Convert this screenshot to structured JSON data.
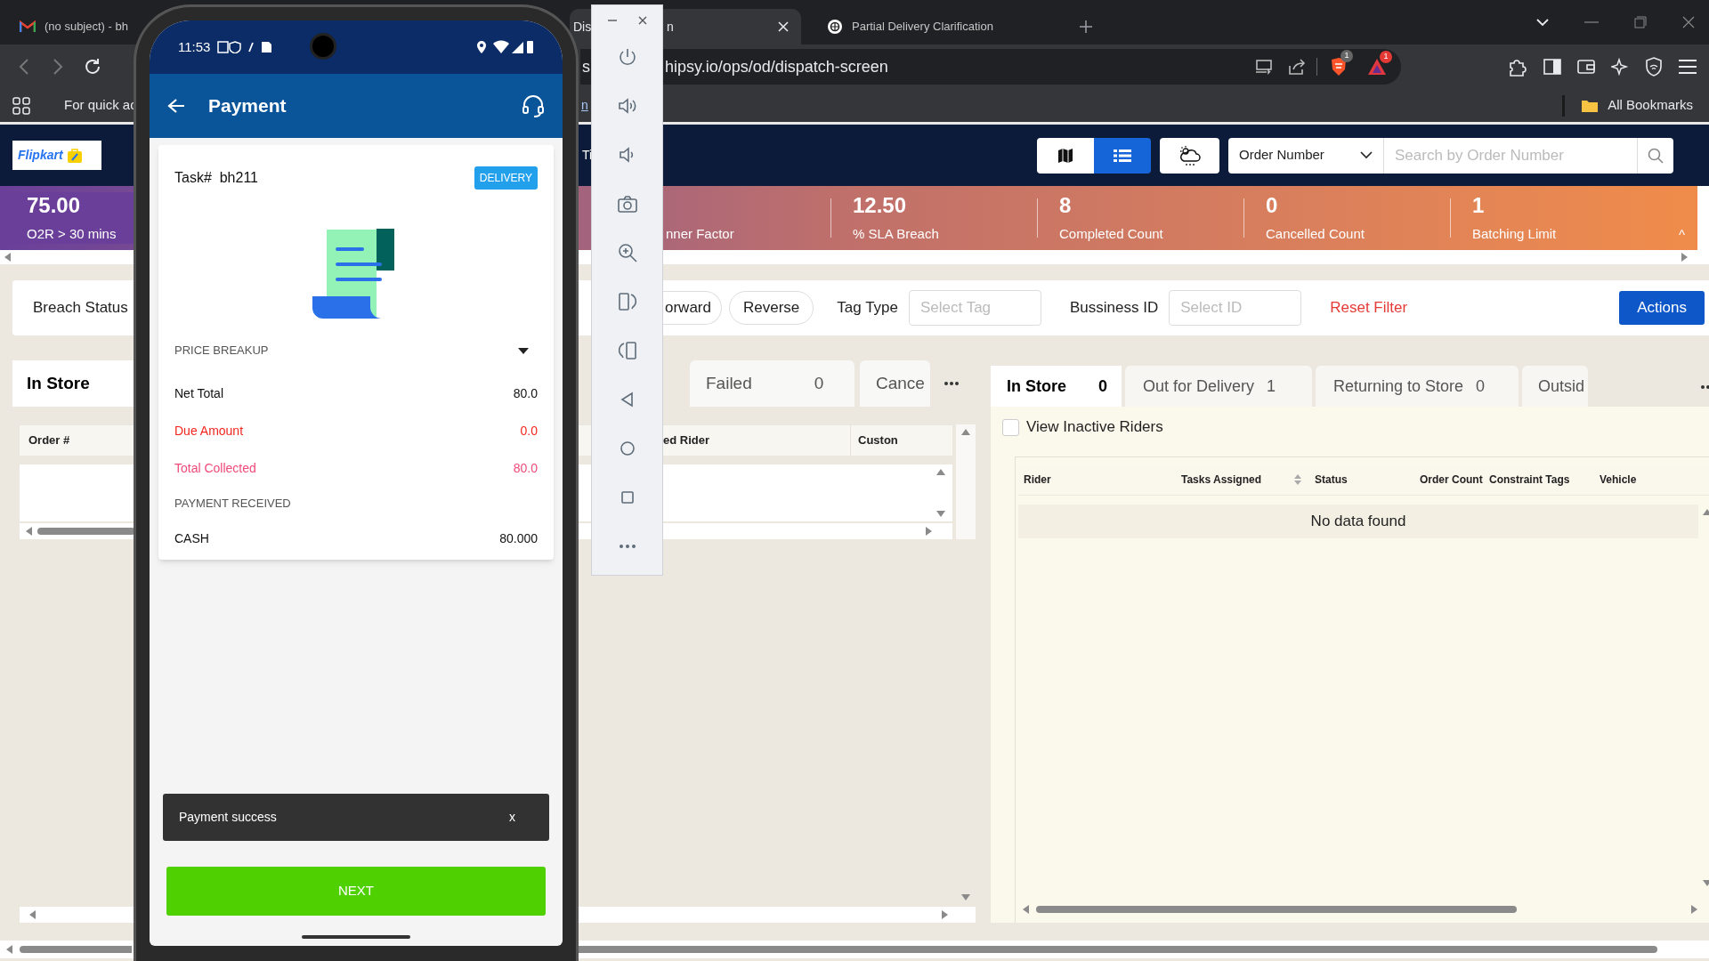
{
  "browser": {
    "tabs": [
      {
        "kind": "mail",
        "title": "(no subject) - bh",
        "selected": false
      },
      {
        "title": "Dis",
        "title_tail": "n",
        "selected": true
      },
      {
        "kind": "chat",
        "title": "Partial Delivery Clarification",
        "selected": false
      }
    ],
    "address": {
      "url_head": "s",
      "url_tail": "hipsy.io/ops/od/dispatch-screen"
    },
    "shield_count": "1",
    "rewards_count": "1",
    "bookmarks": {
      "hint": "For quick ac",
      "link_fragment": "n",
      "all": "All Bookmarks"
    }
  },
  "header": {
    "logo": "Flipkart",
    "title_fragment": "Ti",
    "view_modes": [
      {
        "kind": "map",
        "selected": false
      },
      {
        "kind": "list",
        "selected": true
      }
    ],
    "search_by": "Order Number",
    "search": {
      "placeholder": "Search by Order Number"
    }
  },
  "stats": [
    {
      "value": "75.00",
      "label": "O2R > 30 mins"
    },
    {
      "label": "nner Factor"
    },
    {
      "value": "12.50",
      "label": "% SLA Breach"
    },
    {
      "value": "8",
      "label": "Completed Count"
    },
    {
      "value": "0",
      "label": "Cancelled Count"
    },
    {
      "value": "1",
      "label": "Batching Limit"
    }
  ],
  "stats_toggle": "^",
  "filters": {
    "breach_status": "Breach Status",
    "direction": [
      {
        "label": "orward"
      },
      {
        "label": "Reverse"
      }
    ],
    "tag_type": {
      "label": "Tag Type",
      "placeholder": "Select Tag"
    },
    "business_id": {
      "label": "Bussiness ID",
      "placeholder": "Select ID"
    },
    "reset": "Reset Filter",
    "actions": "Actions"
  },
  "orders": {
    "tabs": [
      {
        "label": "In Store",
        "selected": true
      },
      {
        "label": "Failed",
        "count": "0",
        "selected": false
      },
      {
        "label": "Cance",
        "selected": false
      }
    ],
    "columns": [
      "Order #",
      "ed Rider",
      "Custon"
    ]
  },
  "riders": {
    "tabs": [
      {
        "label": "In Store",
        "count": "0",
        "selected": true
      },
      {
        "label": "Out for Delivery",
        "count": "1",
        "selected": false
      },
      {
        "label": "Returning to Store",
        "count": "0",
        "selected": false
      },
      {
        "label": "Outsid",
        "selected": false
      }
    ],
    "view_inactive": {
      "label": "View Inactive Riders",
      "checked": false
    },
    "columns": [
      {
        "label": "Rider"
      },
      {
        "label": "Tasks Assigned",
        "sortable": true
      },
      {
        "label": "Status"
      },
      {
        "label": "Order Count"
      },
      {
        "label": "Constraint Tags"
      },
      {
        "label": "Vehicle"
      }
    ],
    "empty": "No data found"
  },
  "phone": {
    "time": "11:53",
    "title": "Payment",
    "task": {
      "text": "Task#  bh211",
      "type": "DELIVERY"
    },
    "price_breakup": {
      "title": "PRICE BREAKUP",
      "expanded": true
    },
    "lines": [
      {
        "kind": "normal",
        "label": "Net Total",
        "value": "80.0"
      },
      {
        "kind": "due",
        "label": "Due Amount",
        "value": "0.0"
      },
      {
        "kind": "collected",
        "label": "Total Collected",
        "value": "80.0"
      }
    ],
    "payment_received": {
      "title": "PAYMENT RECEIVED",
      "methods": [
        {
          "label": "CASH",
          "amount": "80.000"
        }
      ]
    },
    "snackbar": {
      "message": "Payment success",
      "close": "x"
    },
    "next": "NEXT"
  }
}
